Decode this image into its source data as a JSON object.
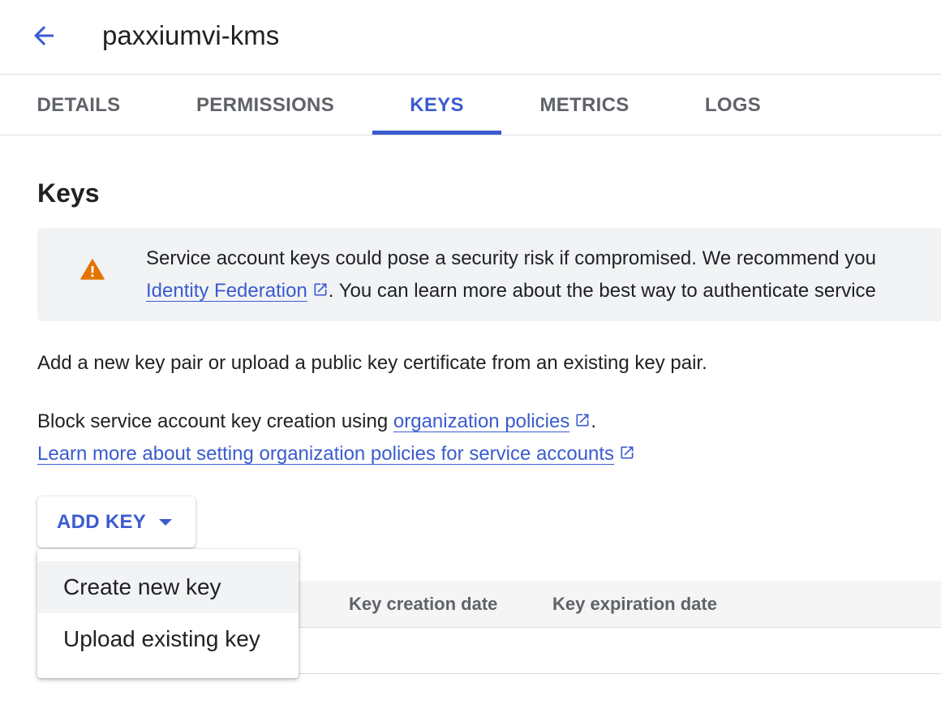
{
  "header": {
    "title": "paxxiumvi-kms",
    "back_icon": "arrow-back-icon"
  },
  "tabs": [
    {
      "label": "DETAILS",
      "active": false
    },
    {
      "label": "PERMISSIONS",
      "active": false
    },
    {
      "label": "KEYS",
      "active": true
    },
    {
      "label": "METRICS",
      "active": false
    },
    {
      "label": "LOGS",
      "active": false
    }
  ],
  "section": {
    "heading": "Keys"
  },
  "banner": {
    "icon": "warning-icon",
    "line1": "Service account keys could pose a security risk if compromised. We recommend you",
    "link_text": "Identity Federation",
    "line2_rest": ". You can learn more about the best way to authenticate service"
  },
  "description": "Add a new key pair or upload a public key certificate from an existing key pair.",
  "policy": {
    "prefix": "Block service account key creation using ",
    "link_text": "organization policies",
    "suffix": ".",
    "learn_more": "Learn more about setting organization policies for service accounts"
  },
  "add_key": {
    "label": "ADD KEY"
  },
  "dropdown": {
    "items": [
      "Create new key",
      "Upload existing key"
    ]
  },
  "table": {
    "columns": [
      "Key creation date",
      "Key expiration date"
    ]
  },
  "colors": {
    "accent": "#3b5bcf",
    "warning": "#e37400"
  }
}
